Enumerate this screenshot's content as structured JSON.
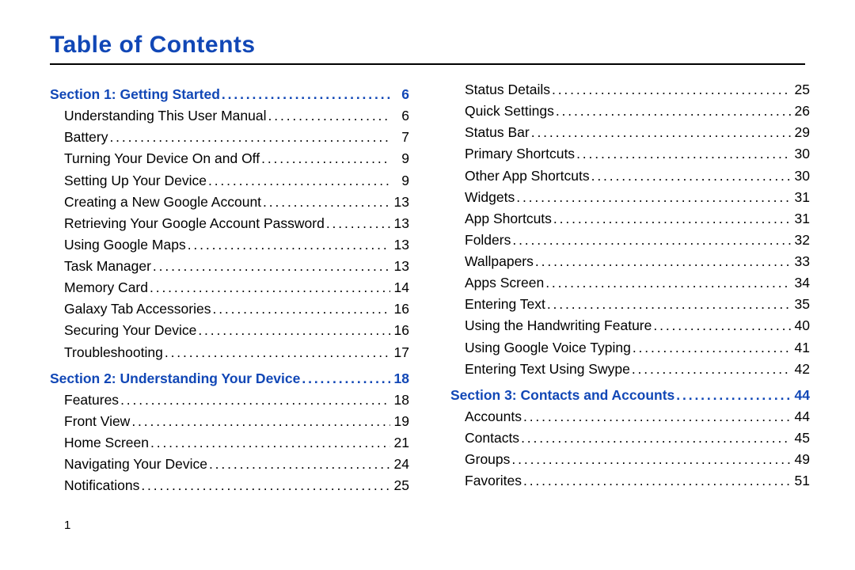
{
  "title": "Table of Contents",
  "page_number": "1",
  "columns": [
    [
      {
        "type": "section",
        "label": "Section 1:  Getting Started",
        "page": "6"
      },
      {
        "type": "entry",
        "label": "Understanding This User Manual",
        "page": "6"
      },
      {
        "type": "entry",
        "label": "Battery",
        "page": "7"
      },
      {
        "type": "entry",
        "label": "Turning Your Device On and Off",
        "page": "9"
      },
      {
        "type": "entry",
        "label": "Setting Up Your Device",
        "page": "9"
      },
      {
        "type": "entry",
        "label": "Creating a New Google Account",
        "page": "13"
      },
      {
        "type": "entry",
        "label": "Retrieving Your Google Account Password",
        "page": "13"
      },
      {
        "type": "entry",
        "label": "Using Google Maps",
        "page": "13"
      },
      {
        "type": "entry",
        "label": "Task Manager",
        "page": "13"
      },
      {
        "type": "entry",
        "label": "Memory Card",
        "page": "14"
      },
      {
        "type": "entry",
        "label": "Galaxy Tab Accessories",
        "page": "16"
      },
      {
        "type": "entry",
        "label": "Securing Your Device",
        "page": "16"
      },
      {
        "type": "entry",
        "label": "Troubleshooting",
        "page": "17"
      },
      {
        "type": "section",
        "label": "Section 2:  Understanding Your Device",
        "page": "18"
      },
      {
        "type": "entry",
        "label": "Features",
        "page": "18"
      },
      {
        "type": "entry",
        "label": "Front View",
        "page": "19"
      },
      {
        "type": "entry",
        "label": "Home Screen",
        "page": "21"
      },
      {
        "type": "entry",
        "label": "Navigating Your Device",
        "page": "24"
      },
      {
        "type": "entry",
        "label": "Notifications",
        "page": "25"
      }
    ],
    [
      {
        "type": "entry",
        "label": "Status Details",
        "page": "25"
      },
      {
        "type": "entry",
        "label": "Quick Settings",
        "page": "26"
      },
      {
        "type": "entry",
        "label": "Status Bar",
        "page": "29"
      },
      {
        "type": "entry",
        "label": "Primary Shortcuts",
        "page": "30"
      },
      {
        "type": "entry",
        "label": "Other App Shortcuts",
        "page": "30"
      },
      {
        "type": "entry",
        "label": "Widgets",
        "page": "31"
      },
      {
        "type": "entry",
        "label": "App Shortcuts",
        "page": "31"
      },
      {
        "type": "entry",
        "label": "Folders",
        "page": "32"
      },
      {
        "type": "entry",
        "label": "Wallpapers",
        "page": "33"
      },
      {
        "type": "entry",
        "label": "Apps Screen",
        "page": "34"
      },
      {
        "type": "entry",
        "label": "Entering Text",
        "page": "35"
      },
      {
        "type": "entry",
        "label": "Using the Handwriting Feature",
        "page": "40"
      },
      {
        "type": "entry",
        "label": "Using Google Voice Typing",
        "page": "41"
      },
      {
        "type": "entry",
        "label": "Entering Text Using Swype",
        "page": "42"
      },
      {
        "type": "section",
        "label": "Section 3:  Contacts and Accounts",
        "page": "44"
      },
      {
        "type": "entry",
        "label": "Accounts",
        "page": "44"
      },
      {
        "type": "entry",
        "label": "Contacts",
        "page": "45"
      },
      {
        "type": "entry",
        "label": "Groups",
        "page": "49"
      },
      {
        "type": "entry",
        "label": "Favorites",
        "page": "51"
      }
    ]
  ]
}
